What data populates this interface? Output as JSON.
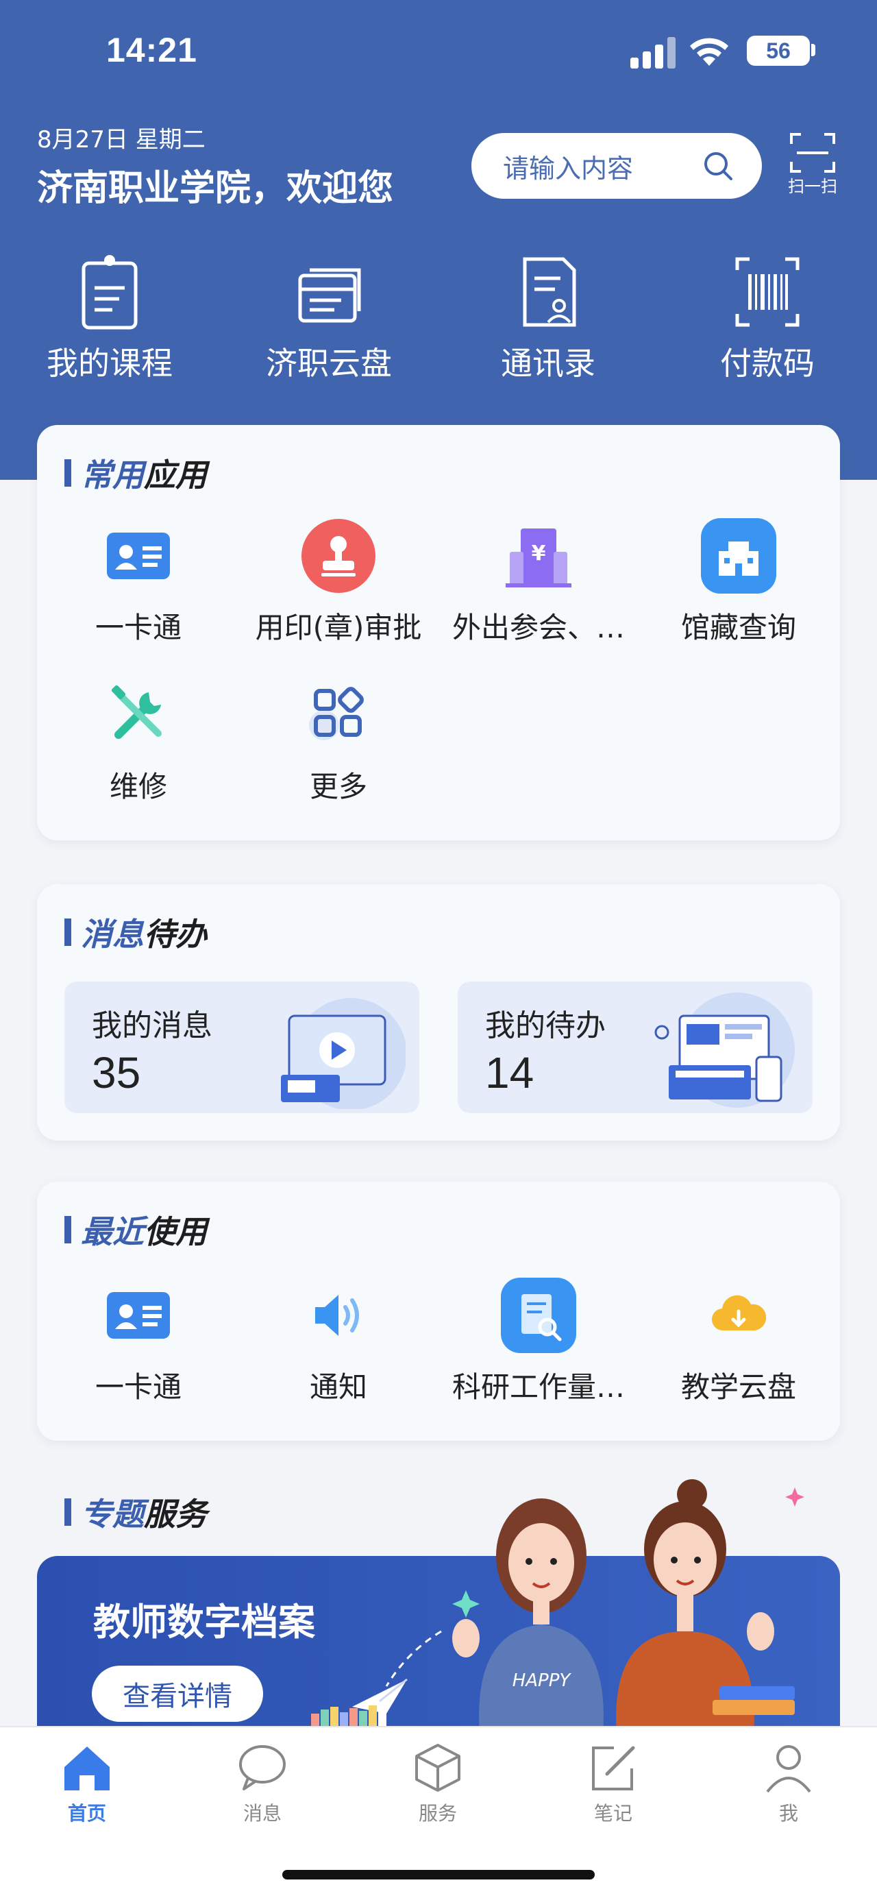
{
  "status_bar": {
    "time": "14:21",
    "battery": "56"
  },
  "header": {
    "date": "8月27日  星期二",
    "welcome": "济南职业学院，欢迎您",
    "search_placeholder": "请输入内容",
    "scan_label": "扫一扫"
  },
  "quick_actions": [
    {
      "label": "我的课程",
      "icon": "clipboard-icon"
    },
    {
      "label": "济职云盘",
      "icon": "cloud-drive-icon"
    },
    {
      "label": "通讯录",
      "icon": "contacts-icon"
    },
    {
      "label": "付款码",
      "icon": "barcode-icon"
    }
  ],
  "common_apps": {
    "title_a": "常用",
    "title_b": "应用",
    "items": [
      {
        "label": "一卡通",
        "icon": "id-card-icon",
        "color": "#3a86ea"
      },
      {
        "label": "用印(章)审批",
        "icon": "stamp-icon",
        "color": "#f0605e"
      },
      {
        "label": "外出参会、…",
        "icon": "building-yuan-icon",
        "color": "#8c6cf0"
      },
      {
        "label": "馆藏查询",
        "icon": "library-icon",
        "color": "#3a94f2"
      },
      {
        "label": "维修",
        "icon": "tools-icon",
        "color": "#2fbf9e"
      },
      {
        "label": "更多",
        "icon": "grid-more-icon",
        "color": "#3f66b8"
      }
    ]
  },
  "messages": {
    "title_a": "消息",
    "title_b": "待办",
    "my_messages_label": "我的消息",
    "my_messages_count": "35",
    "my_todos_label": "我的待办",
    "my_todos_count": "14"
  },
  "recent": {
    "title_a": "最近",
    "title_b": "使用",
    "items": [
      {
        "label": "一卡通",
        "icon": "id-card-icon"
      },
      {
        "label": "通知",
        "icon": "speaker-icon"
      },
      {
        "label": "科研工作量…",
        "icon": "research-doc-icon"
      },
      {
        "label": "教学云盘",
        "icon": "cloud-download-icon"
      }
    ]
  },
  "topics": {
    "title_a": "专题",
    "title_b": "服务",
    "banner_title": "教师数字档案",
    "banner_button": "查看详情"
  },
  "tabbar": [
    {
      "label": "首页",
      "active": true
    },
    {
      "label": "消息",
      "active": false
    },
    {
      "label": "服务",
      "active": false
    },
    {
      "label": "笔记",
      "active": false
    },
    {
      "label": "我",
      "active": false
    }
  ],
  "colors": {
    "primary": "#4065ae",
    "tab_active": "#3a7bea"
  }
}
